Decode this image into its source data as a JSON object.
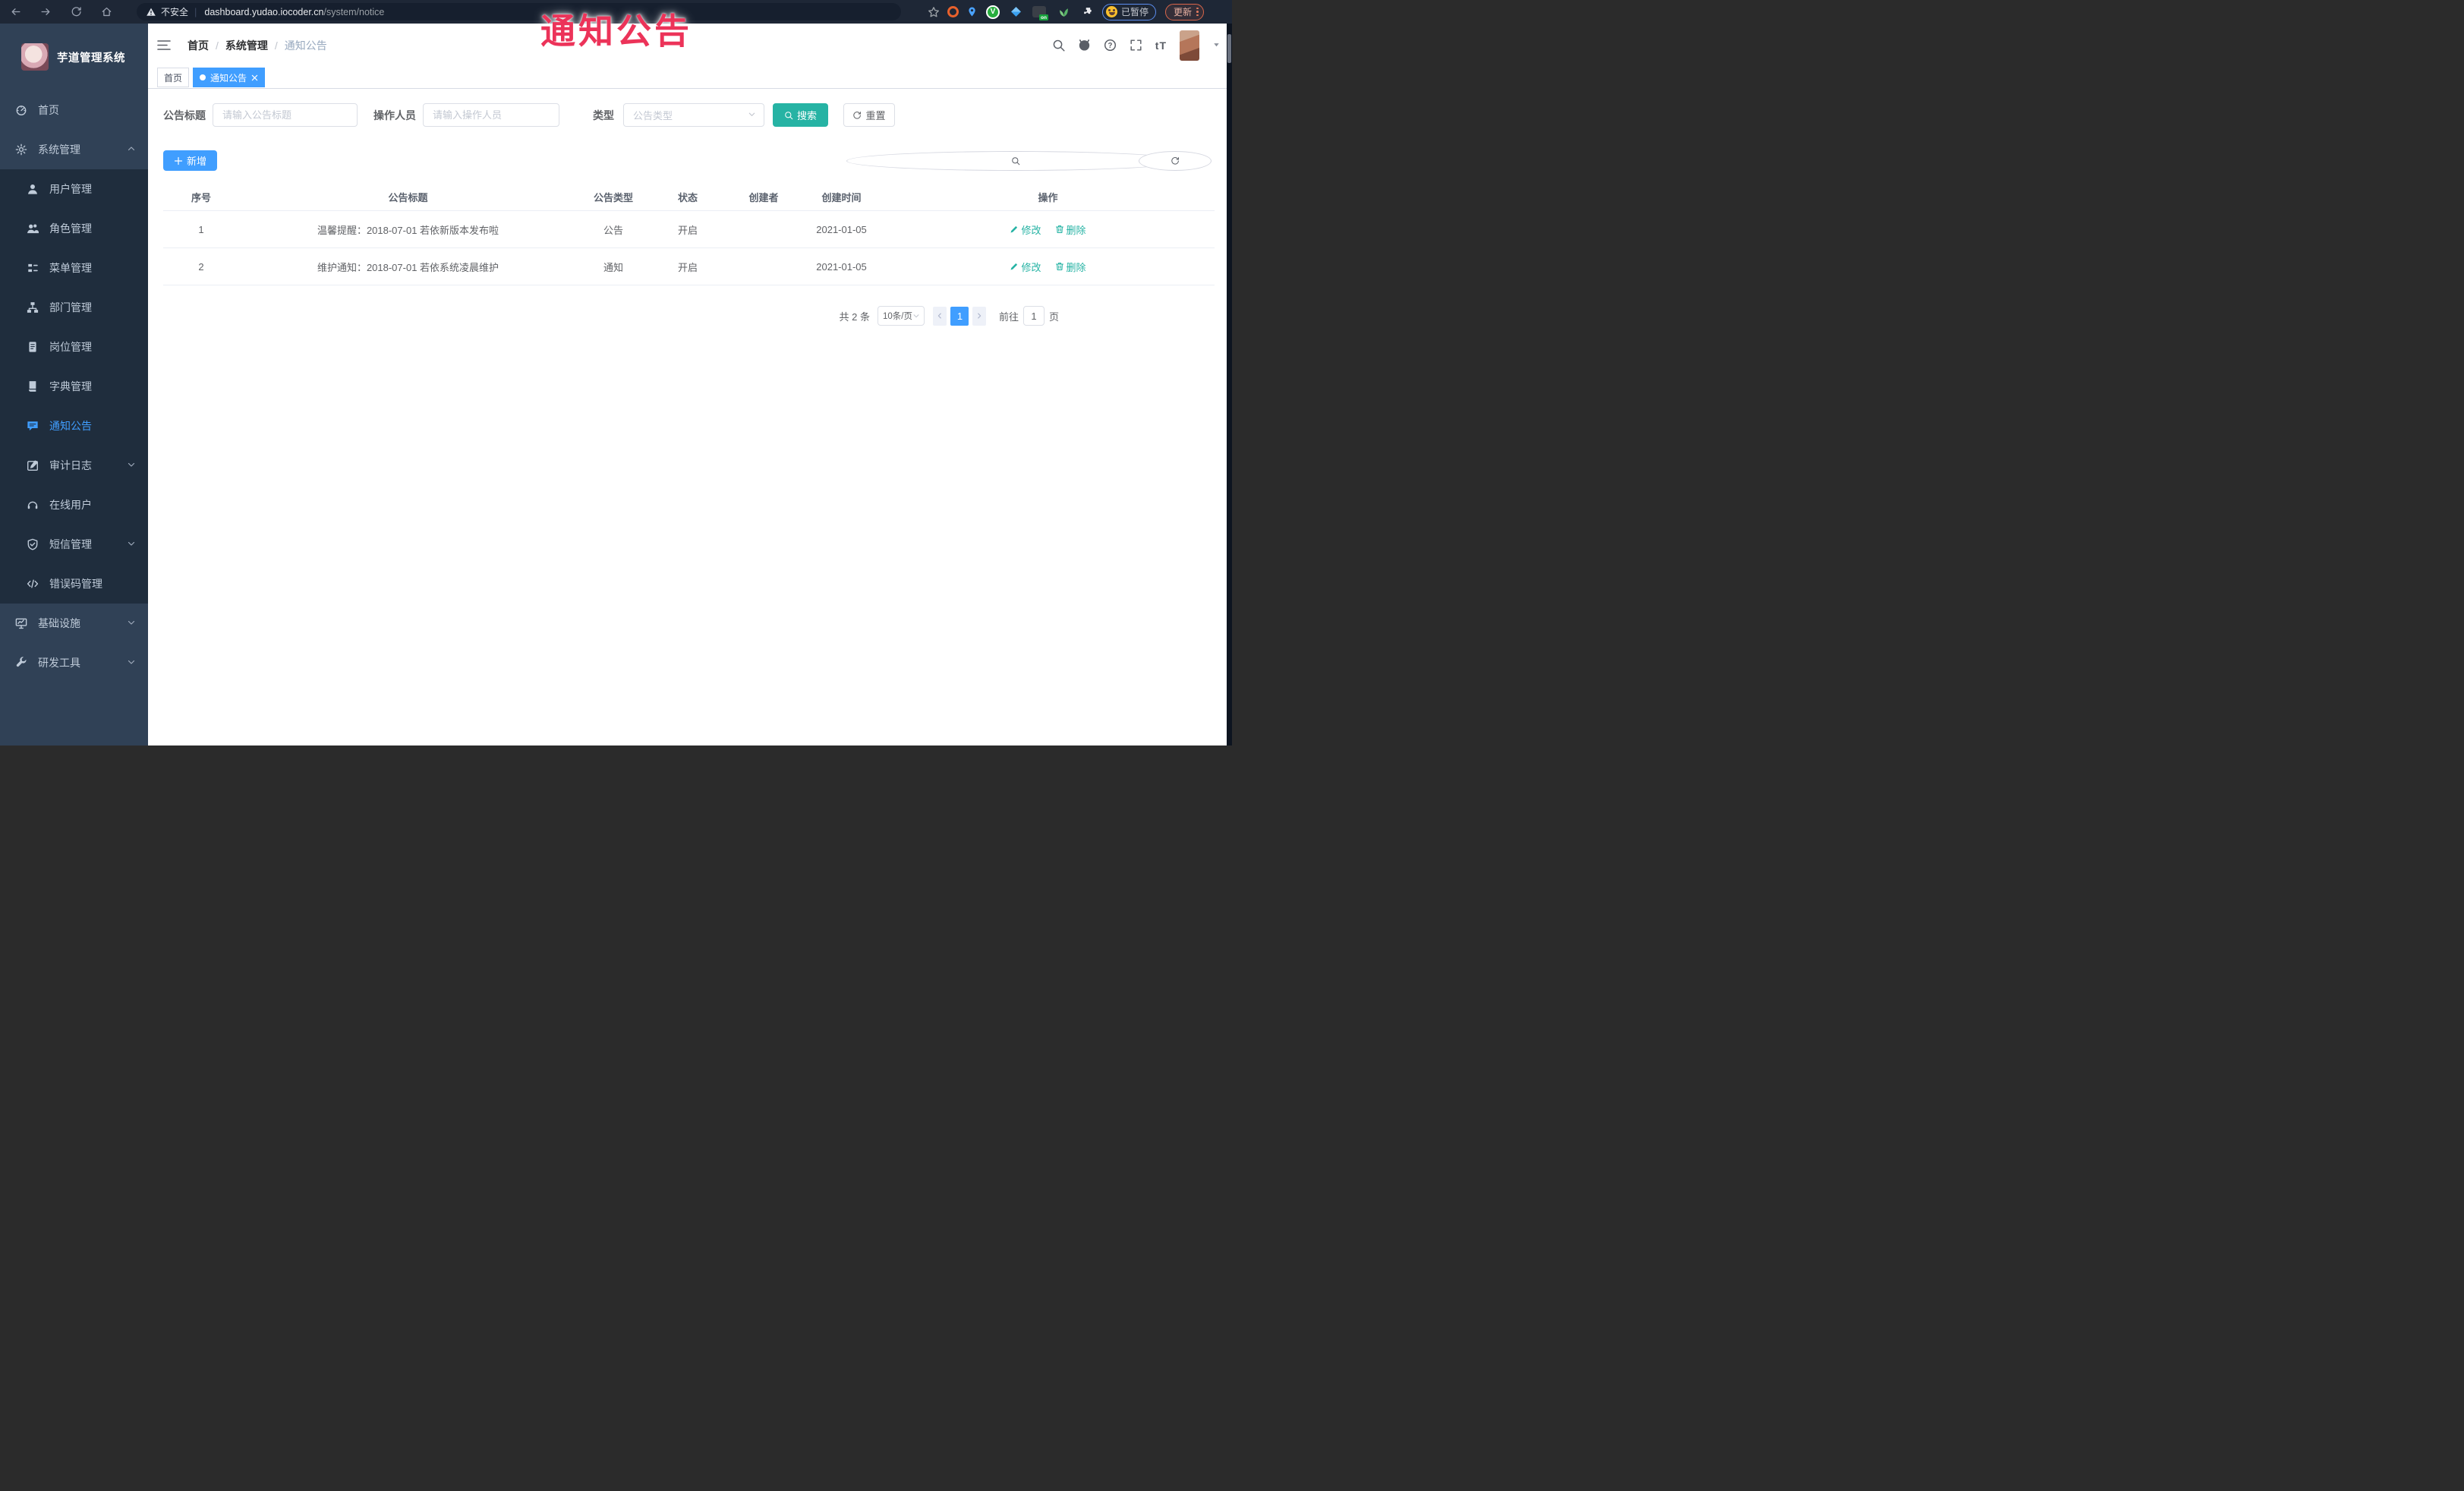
{
  "browser": {
    "security_label": "不安全",
    "url_host": "dashboard.yudao.iocoder.cn",
    "url_path": "/system/notice",
    "extension_badge": "on",
    "green_ext_letter": "V",
    "paused_badge": "已暂停",
    "update_button": "更新"
  },
  "overlay": {
    "watermark": "通知公告"
  },
  "sidebar": {
    "app_title": "芋道管理系统",
    "items": [
      {
        "label": "首页",
        "icon": "dashboard",
        "type": "top"
      },
      {
        "label": "系统管理",
        "icon": "gear",
        "type": "top",
        "chevron": "up"
      },
      {
        "label": "用户管理",
        "icon": "user",
        "type": "sub"
      },
      {
        "label": "角色管理",
        "icon": "users",
        "type": "sub"
      },
      {
        "label": "菜单管理",
        "icon": "menutree",
        "type": "sub"
      },
      {
        "label": "部门管理",
        "icon": "orgtree",
        "type": "sub"
      },
      {
        "label": "岗位管理",
        "icon": "post",
        "type": "sub"
      },
      {
        "label": "字典管理",
        "icon": "dict",
        "type": "sub"
      },
      {
        "label": "通知公告",
        "icon": "notice",
        "type": "sub",
        "active": true
      },
      {
        "label": "审计日志",
        "icon": "log",
        "type": "sub",
        "chevron": "down"
      },
      {
        "label": "在线用户",
        "icon": "online",
        "type": "sub"
      },
      {
        "label": "短信管理",
        "icon": "shield",
        "type": "sub",
        "chevron": "down"
      },
      {
        "label": "错误码管理",
        "icon": "code",
        "type": "sub"
      },
      {
        "label": "基础设施",
        "icon": "monitor",
        "type": "top",
        "chevron": "down"
      },
      {
        "label": "研发工具",
        "icon": "tools",
        "type": "top",
        "chevron": "down"
      }
    ]
  },
  "topnav": {
    "breadcrumb": [
      "首页",
      "系统管理",
      "通知公告"
    ],
    "font_size_label": "tT"
  },
  "tabs": [
    {
      "label": "首页",
      "active": false
    },
    {
      "label": "通知公告",
      "active": true,
      "closable": true
    }
  ],
  "filters": {
    "title_label": "公告标题",
    "title_placeholder": "请输入公告标题",
    "operator_label": "操作人员",
    "operator_placeholder": "请输入操作人员",
    "type_label": "类型",
    "type_placeholder": "公告类型",
    "search_label": "搜索",
    "reset_label": "重置"
  },
  "toolbar": {
    "add_label": "新增"
  },
  "table": {
    "columns": [
      "序号",
      "公告标题",
      "公告类型",
      "状态",
      "创建者",
      "创建时间",
      "操作"
    ],
    "rows": [
      {
        "index": "1",
        "title": "温馨提醒：2018-07-01 若依新版本发布啦",
        "type": "公告",
        "status": "开启",
        "creator": "",
        "created_at": "2021-01-05"
      },
      {
        "index": "2",
        "title": "维护通知：2018-07-01 若依系统凌晨维护",
        "type": "通知",
        "status": "开启",
        "creator": "",
        "created_at": "2021-01-05"
      }
    ],
    "edit_label": "修改",
    "delete_label": "删除"
  },
  "pagination": {
    "total_text": "共 2 条",
    "page_size": "10条/页",
    "current_page": "1",
    "goto_label": "前往",
    "goto_value": "1",
    "page_unit": "页"
  },
  "colors": {
    "accent_blue": "#409EFF",
    "search_teal": "#26b3a4",
    "watermark_red": "#ec3359",
    "sidebar_bg": "#304156",
    "submenu_bg": "#1f2d3d"
  }
}
